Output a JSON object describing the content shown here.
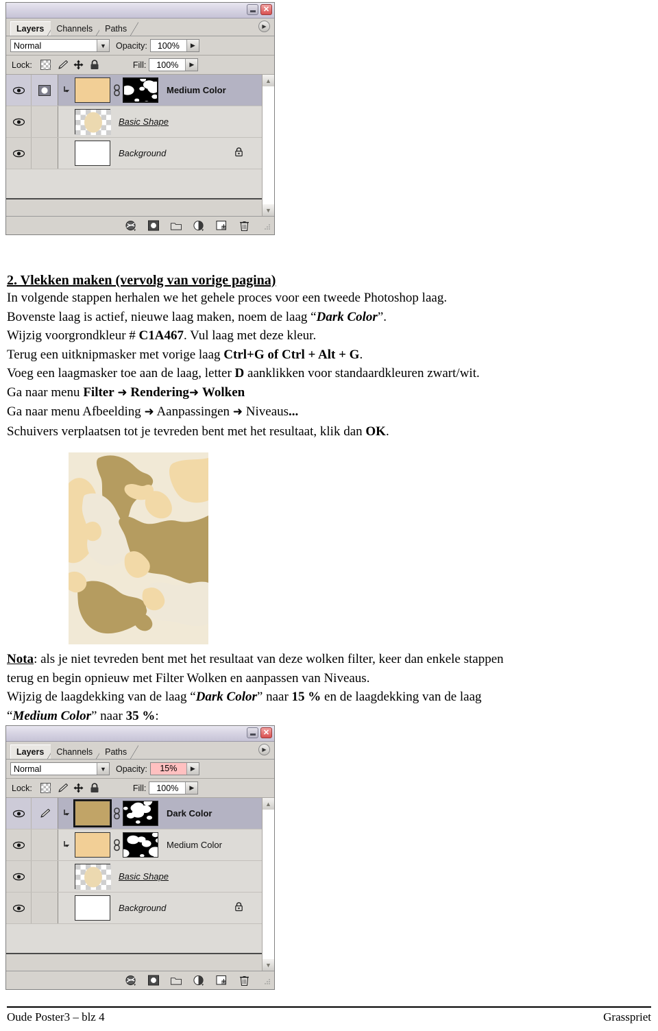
{
  "panels": [
    {
      "id": "layers-panel-top",
      "title_buttons": [
        "minimize",
        "close"
      ],
      "tabs": [
        {
          "label": "Layers",
          "active": true
        },
        {
          "label": "Channels",
          "active": false
        },
        {
          "label": "Paths",
          "active": false
        }
      ],
      "blend_mode": "Normal",
      "opacity_label": "Opacity:",
      "opacity_value": "100%",
      "opacity_highlighted": false,
      "lock_label": "Lock:",
      "lock_icons": [
        "lock-transparency-icon",
        "lock-image-icon",
        "lock-position-icon",
        "lock-all-icon"
      ],
      "fill_label": "Fill:",
      "fill_value": "100%",
      "layers": [
        {
          "name": "Medium Color",
          "selected": true,
          "style": "bold",
          "visible": true,
          "clipped": true,
          "has_mask": true,
          "mask_selected": true,
          "thumb_color": "#f2cf96",
          "thumb_type": "solid",
          "locked": false,
          "second_cell": "mask-selected-icon"
        },
        {
          "name": "Basic Shape",
          "selected": false,
          "style": "underline-italic",
          "visible": true,
          "clipped": false,
          "has_mask": false,
          "thumb_color": "#ecd9b0",
          "thumb_type": "transparent",
          "locked": false,
          "second_cell": "empty"
        },
        {
          "name": "Background",
          "selected": false,
          "style": "italic",
          "visible": true,
          "clipped": false,
          "has_mask": false,
          "thumb_color": "#ffffff",
          "thumb_type": "solid",
          "locked": true,
          "second_cell": "empty"
        }
      ],
      "footer_buttons": [
        "layer-style-icon",
        "layer-mask-icon",
        "new-group-icon",
        "adjustment-layer-icon",
        "new-layer-icon",
        "delete-layer-icon"
      ]
    },
    {
      "id": "layers-panel-bottom",
      "title_buttons": [
        "minimize",
        "close"
      ],
      "tabs": [
        {
          "label": "Layers",
          "active": true
        },
        {
          "label": "Channels",
          "active": false
        },
        {
          "label": "Paths",
          "active": false
        }
      ],
      "blend_mode": "Normal",
      "opacity_label": "Opacity:",
      "opacity_value": "15%",
      "opacity_highlighted": true,
      "lock_label": "Lock:",
      "lock_icons": [
        "lock-transparency-icon",
        "lock-image-icon",
        "lock-position-icon",
        "lock-all-icon"
      ],
      "fill_label": "Fill:",
      "fill_value": "100%",
      "layers": [
        {
          "name": "Dark Color",
          "selected": true,
          "style": "bold",
          "visible": true,
          "clipped": true,
          "has_mask": true,
          "mask_selected": false,
          "thumb_color": "#c1a467",
          "thumb_type": "solid",
          "locked": false,
          "second_cell": "brush-icon"
        },
        {
          "name": "Medium Color",
          "selected": false,
          "style": "normal",
          "visible": true,
          "clipped": true,
          "has_mask": true,
          "mask_selected": false,
          "thumb_color": "#f2cf96",
          "thumb_type": "solid",
          "locked": false,
          "second_cell": "empty"
        },
        {
          "name": "Basic Shape",
          "selected": false,
          "style": "underline-italic",
          "visible": true,
          "clipped": false,
          "has_mask": false,
          "thumb_color": "#ecd9b0",
          "thumb_type": "transparent",
          "locked": false,
          "second_cell": "empty"
        },
        {
          "name": "Background",
          "selected": false,
          "style": "italic",
          "visible": true,
          "clipped": false,
          "has_mask": false,
          "thumb_color": "#ffffff",
          "thumb_type": "solid",
          "locked": true,
          "second_cell": "empty"
        }
      ],
      "footer_buttons": [
        "layer-style-icon",
        "layer-mask-icon",
        "new-group-icon",
        "adjustment-layer-icon",
        "new-layer-icon",
        "delete-layer-icon"
      ]
    }
  ],
  "document": {
    "heading": "2. Vlekken maken (vervolg van vorige pagina)",
    "line1": "In volgende stappen herhalen we het gehele proces voor een tweede Photoshop laag.",
    "line2_a": "Bovenste laag is actief, nieuwe laag maken, noem de laag “",
    "line2_b": "Dark Color",
    "line2_c": "”.",
    "line3_a": "Wijzig voorgrondkleur # ",
    "line3_b": "C1A467",
    "line3_c": ". Vul laag met deze kleur.",
    "line4_a": "Terug een uitknipmasker met vorige laag ",
    "line4_b": "Ctrl+G of  Ctrl + Alt + G",
    "line4_c": ".",
    "line5_a": "Voeg een laagmasker toe aan de laag, letter ",
    "line5_b": "D",
    "line5_c": " aanklikken voor standaardkleuren zwart/wit.",
    "line6_a": "Ga naar menu ",
    "line6_b": "Filter",
    "line6_c": "Rendering",
    "line6_d": "Wolken",
    "line7_a": "Ga naar menu Afbeelding ",
    "line7_b": "Aanpassingen ",
    "line7_c": "Niveaus",
    "line7_d": "...",
    "line8_a": "Schuivers verplaatsen tot je tevreden bent met het resultaat, klik dan ",
    "line8_b": "OK",
    "line8_c": ".",
    "nota_label": "Nota",
    "nota_a": ": als je niet tevreden bent met het resultaat van deze wolken filter, keer dan enkele stappen",
    "nota_b": "terug en begin opnieuw met Filter Wolken en aanpassen van Niveaus.",
    "line9_a": "Wijzig de laagdekking van de laag “",
    "line9_b": "Dark Color",
    "line9_c": "”  naar ",
    "line9_d": "15 %",
    "line9_e": " en de laagdekking van de laag",
    "line10_a": "“",
    "line10_b": "Medium Color",
    "line10_c": "” naar ",
    "line10_d": "35 %",
    "line10_e": ":",
    "arrow_glyph": "➜"
  },
  "clouds_image": {
    "alt": "camouflage-clouds-render",
    "base_color": "#f1e9d6",
    "mid_color": "#f2d9a7",
    "dark_color": "#b59c60",
    "light_color": "#efe8d8"
  },
  "page_footer": {
    "left": "Oude Poster3 – blz 4",
    "right": "Grasspriet"
  }
}
